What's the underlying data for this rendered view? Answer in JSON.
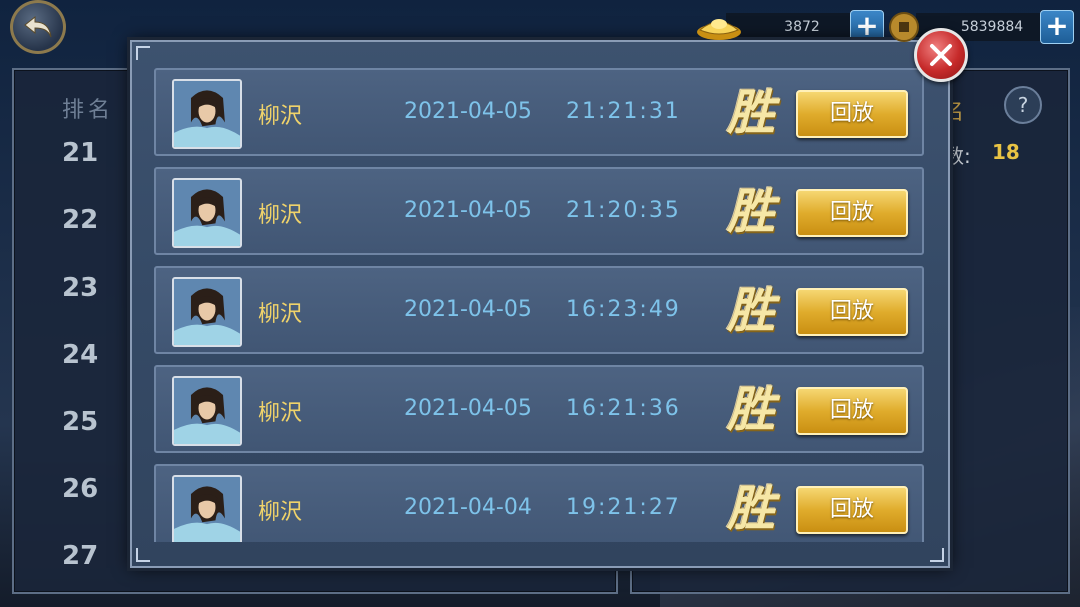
{
  "currency": {
    "gold": {
      "amount": "3872",
      "icon": "gold-ingot-icon"
    },
    "coin": {
      "amount": "5839884",
      "icon": "copper-coin-icon"
    },
    "plus_label": "+"
  },
  "ranking": {
    "header": "排名",
    "ranks": [
      "21",
      "22",
      "23",
      "24",
      "25",
      "26",
      "27"
    ],
    "right_title_fragment": "名",
    "help_label": "?",
    "count_label": "数:",
    "count_value": "18"
  },
  "battle_records": [
    {
      "name": "柳沢",
      "date": "2021-04-05",
      "time": "21:21:31",
      "result": "胜",
      "replay_label": "回放"
    },
    {
      "name": "柳沢",
      "date": "2021-04-05",
      "time": "21:20:35",
      "result": "胜",
      "replay_label": "回放"
    },
    {
      "name": "柳沢",
      "date": "2021-04-05",
      "time": "16:23:49",
      "result": "胜",
      "replay_label": "回放"
    },
    {
      "name": "柳沢",
      "date": "2021-04-05",
      "time": "16:21:36",
      "result": "胜",
      "replay_label": "回放"
    },
    {
      "name": "柳沢",
      "date": "2021-04-04",
      "time": "19:21:27",
      "result": "胜",
      "replay_label": "回放"
    }
  ],
  "colors": {
    "accent_gold": "#e0ac2c",
    "name_yellow": "#f0d36a",
    "timestamp_blue": "#7ec3ea",
    "close_red": "#c62a2a"
  }
}
